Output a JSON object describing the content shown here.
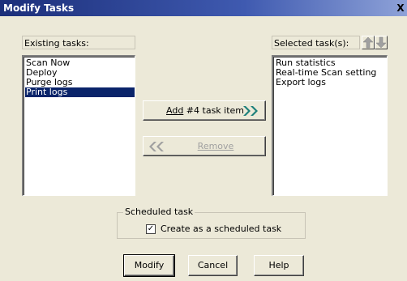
{
  "window": {
    "title": "Modify Tasks",
    "close_label": "X"
  },
  "existing": {
    "label": "Existing tasks:",
    "items": [
      "Scan Now",
      "Deploy",
      "Purge logs",
      "Print logs"
    ],
    "selected": "Print logs"
  },
  "selected_tasks": {
    "label": "Selected task(s):",
    "items": [
      "Run statistics",
      "Real-time Scan setting",
      "Export logs"
    ]
  },
  "buttons": {
    "add_prefix": "Add",
    "add_suffix": "#4  task item",
    "remove_label": "Remove",
    "modify_label": "Modify",
    "cancel_label": "Cancel",
    "help_label": "Help"
  },
  "scheduled": {
    "legend": "Scheduled task",
    "checkbox_label": "Create as a scheduled task",
    "checked_mark": "✓"
  },
  "colors": {
    "selection": "#0a246a",
    "arrow_teal": "#1b7f7a",
    "disabled_text": "#a0a0a0"
  },
  "icons": {
    "add": "double-right-arrow-icon",
    "remove": "double-left-arrow-icon",
    "move_up": "up-arrow-icon",
    "move_down": "down-arrow-icon"
  }
}
